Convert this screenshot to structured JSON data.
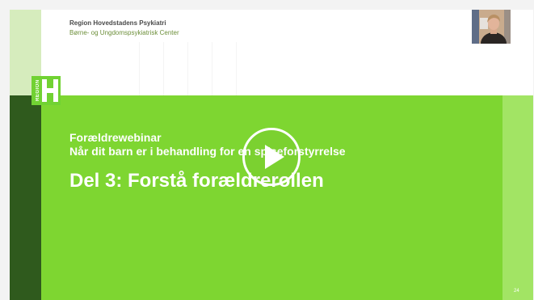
{
  "slide": {
    "org_name": "Region Hovedstadens Psykiatri",
    "org_department": "Børne- og Ungdomspsykiatrisk Center",
    "logo_text": "REGION",
    "subtitle_line1": "Forældrewebinar",
    "subtitle_line2": "Når dit barn er i behandling for en spiseforstyrrelse",
    "title": "Del 3: Forstå forældrerollen",
    "page_number": "24"
  },
  "player": {
    "play_icon": "play-icon",
    "webcam_icon": "presenter-webcam"
  },
  "colors": {
    "slide_green": "#7ed631",
    "dark_green_bar": "#2f5a1d",
    "light_green_bar": "#d6ecbd",
    "right_strip": "#a2e464",
    "dept_text": "#6d8f3a"
  }
}
